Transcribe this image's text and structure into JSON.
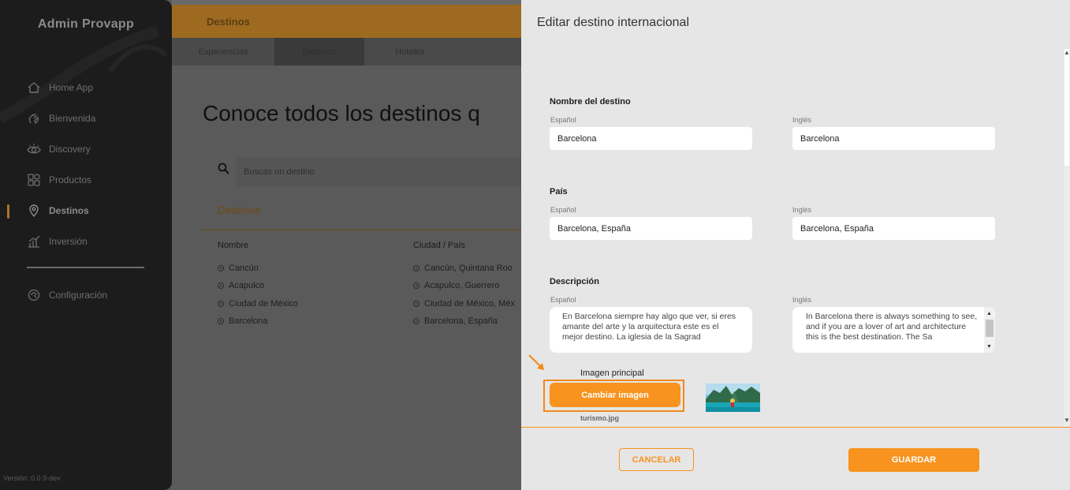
{
  "sidebar": {
    "brand": "Admin Provapp",
    "items": [
      {
        "label": "Home App",
        "icon": "home-icon"
      },
      {
        "label": "Bienvenida",
        "icon": "wave-hand-icon"
      },
      {
        "label": "Discovery",
        "icon": "eye-icon"
      },
      {
        "label": "Productos",
        "icon": "grid-icon"
      },
      {
        "label": "Destinos",
        "icon": "location-pin-icon",
        "active": true
      },
      {
        "label": "Inversión",
        "icon": "bar-chart-icon"
      }
    ],
    "settings": {
      "label": "Configuración",
      "icon": "settings-icon"
    },
    "version": "Versión: 0.0.9-dev"
  },
  "main": {
    "header_title": "Destinos",
    "tabs": [
      {
        "label": "Experiencias"
      },
      {
        "label": "Destinos",
        "active": true
      },
      {
        "label": "Hoteles"
      }
    ],
    "heading": "Conoce todos los destinos q",
    "search": {
      "placeholder": "Buscas un destino"
    },
    "section_label": "Destinos",
    "columns": [
      "Nombre",
      "Ciudad / País"
    ],
    "rows": [
      {
        "name": "Cancún",
        "city": "Cancún, Quintana Roo"
      },
      {
        "name": "Acapulco",
        "city": "Acapulco, Guerrero"
      },
      {
        "name": "Ciudad de México",
        "city": "Ciudad de México, Méx"
      },
      {
        "name": "Barcelona",
        "city": "Barcelona, España"
      }
    ]
  },
  "drawer": {
    "title": "Editar destino internacional",
    "lang_es": "Español",
    "lang_en": "Inglés",
    "fields": {
      "name": {
        "label": "Nombre del destino",
        "es": "Barcelona",
        "en": "Barcelona"
      },
      "country": {
        "label": "País",
        "es": "Barcelona, España",
        "en": "Barcelona, España"
      },
      "description": {
        "label": "Descripción",
        "es": "En Barcelona siempre hay algo que ver, si eres amante del arte y la arquitectura este es el mejor destino. La iglesia de la Sagrad",
        "en": "In Barcelona there is always something to see, and if you are a lover of art and architecture this is the best destination. The Sa"
      }
    },
    "image": {
      "label": "Imagen principal",
      "button": "Cambiar imagen",
      "file_name": "turismo.jpg"
    },
    "cancel": "CANCELAR",
    "save": "GUARDAR"
  },
  "colors": {
    "accent": "#f7931e",
    "sidebar_bg": "#1c1c1c",
    "drawer_bg": "#e6e6e6"
  }
}
